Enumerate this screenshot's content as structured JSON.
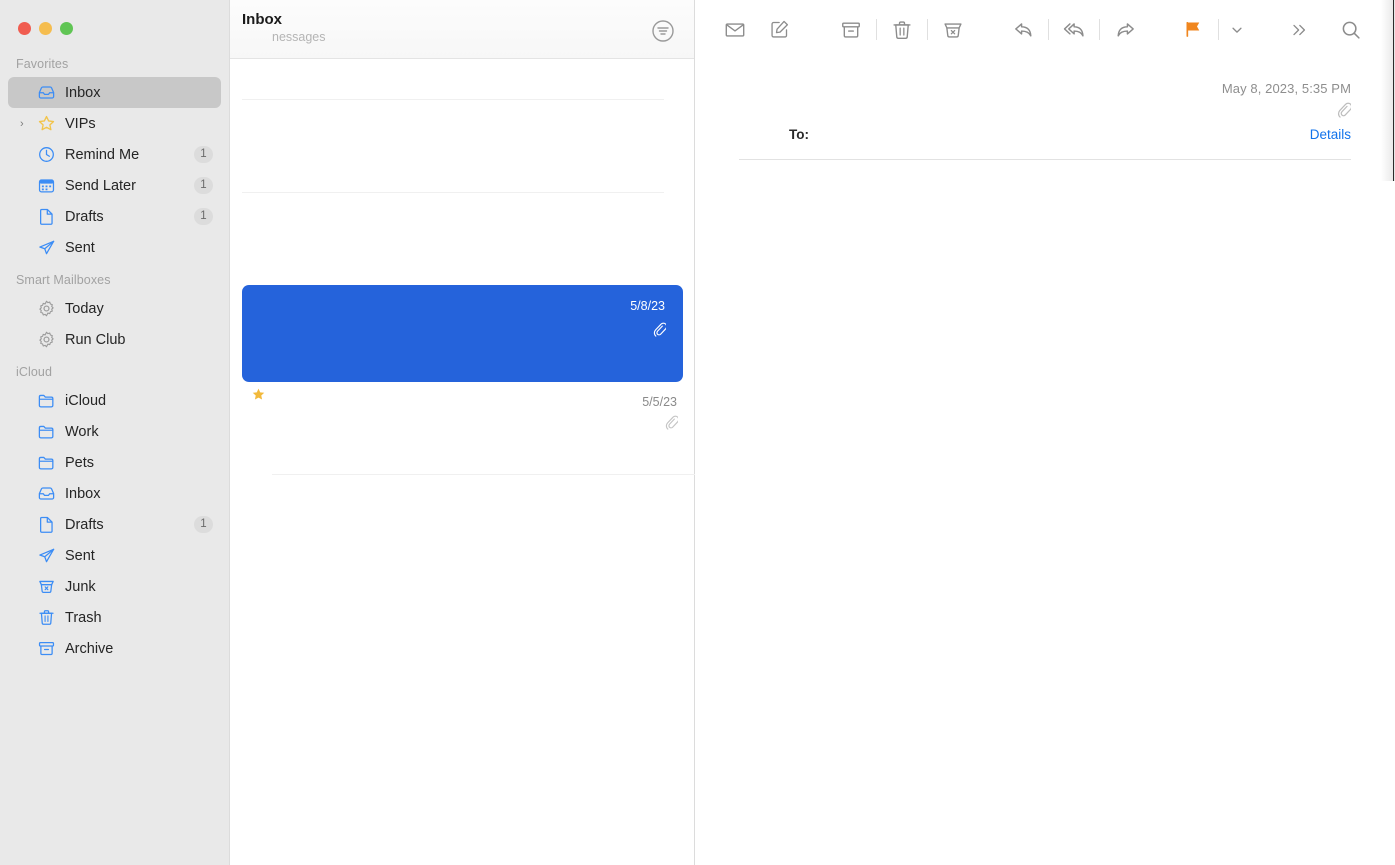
{
  "window": {
    "traffic_lights": [
      {
        "name": "close",
        "color": "#F05C50"
      },
      {
        "name": "minimize",
        "color": "#F5BD4F"
      },
      {
        "name": "zoom",
        "color": "#60C554"
      }
    ]
  },
  "sidebar": {
    "sections": [
      {
        "label": "Favorites",
        "items": [
          {
            "label": "Inbox",
            "icon": "inbox-icon",
            "badge": "",
            "selected": true,
            "disclosure": false
          },
          {
            "label": "VIPs",
            "icon": "star-icon",
            "badge": "",
            "selected": false,
            "disclosure": true
          },
          {
            "label": "Remind Me",
            "icon": "clock-icon",
            "badge": "1",
            "selected": false,
            "disclosure": false
          },
          {
            "label": "Send Later",
            "icon": "calendar-icon",
            "badge": "1",
            "selected": false,
            "disclosure": false
          },
          {
            "label": "Drafts",
            "icon": "document-icon",
            "badge": "1",
            "selected": false,
            "disclosure": false
          },
          {
            "label": "Sent",
            "icon": "paper-plane-icon",
            "badge": "",
            "selected": false,
            "disclosure": false
          }
        ]
      },
      {
        "label": "Smart Mailboxes",
        "items": [
          {
            "label": "Today",
            "icon": "gear-icon",
            "badge": "",
            "selected": false,
            "disclosure": false
          },
          {
            "label": "Run Club",
            "icon": "gear-icon",
            "badge": "",
            "selected": false,
            "disclosure": false
          }
        ]
      },
      {
        "label": "iCloud",
        "items": [
          {
            "label": "iCloud",
            "icon": "folder-icon",
            "badge": "",
            "selected": false,
            "disclosure": false
          },
          {
            "label": "Work",
            "icon": "folder-icon",
            "badge": "",
            "selected": false,
            "disclosure": false
          },
          {
            "label": "Pets",
            "icon": "folder-icon",
            "badge": "",
            "selected": false,
            "disclosure": false
          },
          {
            "label": "Inbox",
            "icon": "inbox-icon",
            "badge": "",
            "selected": false,
            "disclosure": false
          },
          {
            "label": "Drafts",
            "icon": "document-icon",
            "badge": "1",
            "selected": false,
            "disclosure": false
          },
          {
            "label": "Sent",
            "icon": "paper-plane-icon",
            "badge": "",
            "selected": false,
            "disclosure": false
          },
          {
            "label": "Junk",
            "icon": "junk-icon",
            "badge": "",
            "selected": false,
            "disclosure": false
          },
          {
            "label": "Trash",
            "icon": "trash-icon",
            "badge": "",
            "selected": false,
            "disclosure": false
          },
          {
            "label": "Archive",
            "icon": "archive-icon",
            "badge": "",
            "selected": false,
            "disclosure": false
          }
        ]
      }
    ]
  },
  "message_list": {
    "title": "Inbox",
    "subtitle": "nessages",
    "filter_icon": "filter-icon",
    "messages": [
      {
        "date": "5/8/23",
        "selected": true,
        "attachment": true,
        "vip": false
      },
      {
        "date": "5/5/23",
        "selected": false,
        "attachment": true,
        "vip": true
      }
    ]
  },
  "toolbar": {
    "buttons": [
      {
        "name": "mark-unread-button",
        "icon": "envelope-icon"
      },
      {
        "name": "compose-button",
        "icon": "compose-icon"
      },
      {
        "name": "archive-button",
        "icon": "archive-icon"
      },
      {
        "name": "delete-button",
        "icon": "trash-icon"
      },
      {
        "name": "junk-button",
        "icon": "junk-icon"
      },
      {
        "name": "reply-button",
        "icon": "reply-icon"
      },
      {
        "name": "reply-all-button",
        "icon": "reply-all-icon"
      },
      {
        "name": "forward-button",
        "icon": "forward-icon"
      },
      {
        "name": "flag-button",
        "icon": "flag-icon"
      },
      {
        "name": "flag-menu-button",
        "icon": "chevron-down-icon"
      },
      {
        "name": "overflow-button",
        "icon": "double-chevron-right-icon"
      },
      {
        "name": "search-button",
        "icon": "search-icon"
      }
    ],
    "flag_color": "#F0861E"
  },
  "reading_pane": {
    "date": "May 8, 2023, 5:35 PM",
    "attachment_icon": "paperclip-icon",
    "to_label": "To:",
    "details_label": "Details",
    "details_color": "#1273EB"
  },
  "colors": {
    "selection_blue": "#2563DB",
    "sidebar_bg": "#E9E9E9",
    "sidebar_selected": "#C8C8C8"
  }
}
